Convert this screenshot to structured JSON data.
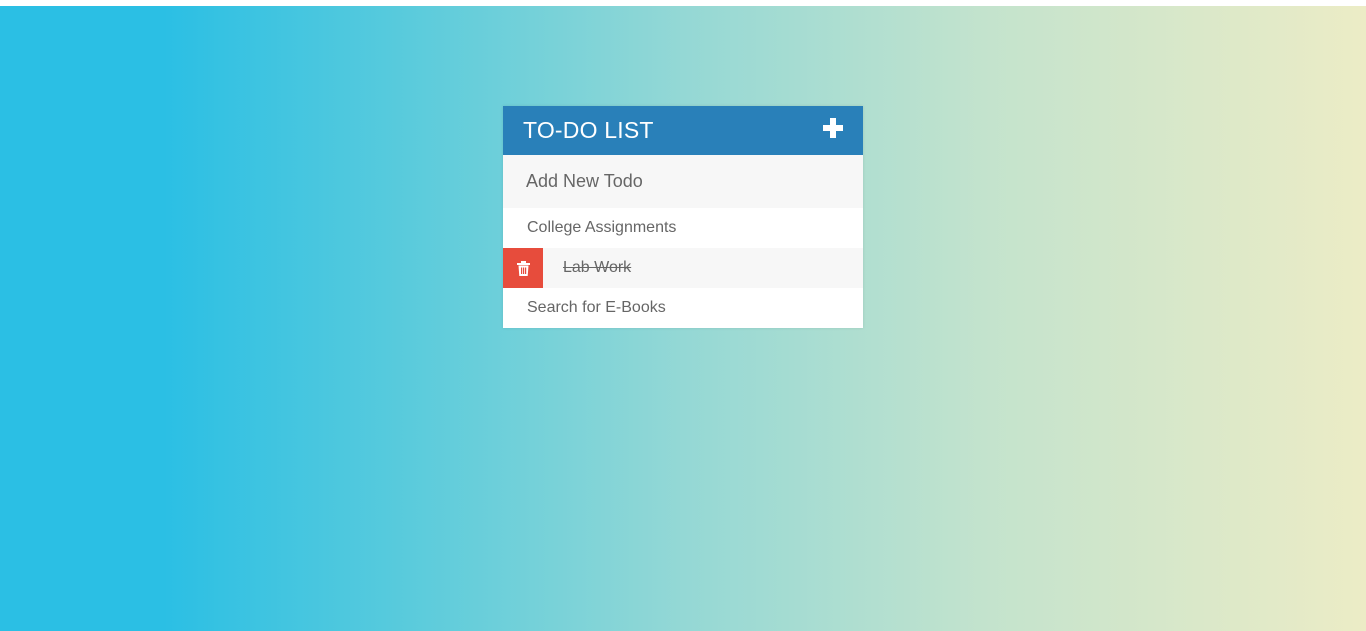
{
  "header": {
    "title": "TO-DO LIST",
    "add_icon": "plus-icon"
  },
  "new_todo": {
    "placeholder": "Add New Todo",
    "value": ""
  },
  "todos": [
    {
      "text": "College Assignments",
      "completed": false,
      "delete_visible": false
    },
    {
      "text": " Lab Work",
      "completed": true,
      "delete_visible": true,
      "delete_icon": "trash-icon"
    },
    {
      "text": "Search for E-Books",
      "completed": false,
      "delete_visible": false
    }
  ],
  "colors": {
    "header_bg": "#2980b9",
    "delete_bg": "#e74c3c",
    "gradient_start": "#2bbfe4",
    "gradient_end": "#ececc6"
  }
}
